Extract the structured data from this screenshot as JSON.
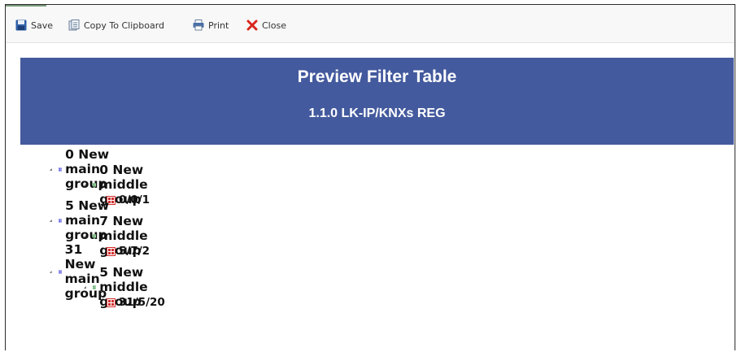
{
  "toolbar": {
    "save_label": "Save",
    "copy_label": "Copy To Clipboard",
    "print_label": "Print",
    "close_label": "Close"
  },
  "banner": {
    "title": "Preview Filter Table",
    "subtitle": "1.1.0 LK-IP/KNXs REG"
  },
  "tree": {
    "groups": [
      {
        "label": "0 New main group",
        "middle": {
          "label": "0 New middle group",
          "address": "0/0/1"
        }
      },
      {
        "label": "5 New main group",
        "middle": {
          "label": "7 New middle group",
          "address": "5/7/2"
        }
      },
      {
        "label": "31 New main group",
        "middle": {
          "label": "5 New middle group",
          "address": "31/5/20"
        }
      }
    ]
  },
  "colors": {
    "banner": "#445a9e",
    "main_group_icon": "#3a3adb",
    "middle_group_icon": "#2e9a3a",
    "address_icon": "#d12c2c",
    "close_icon": "#d9261c"
  }
}
